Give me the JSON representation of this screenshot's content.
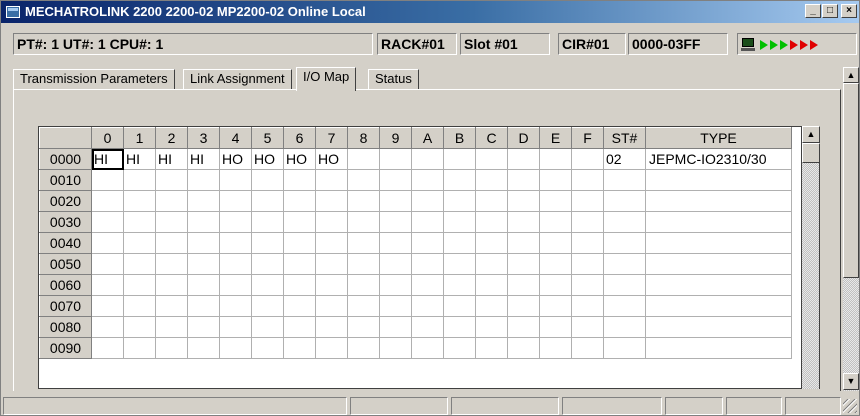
{
  "window": {
    "title": "MECHATROLINK   2200  2200-02  MP2200-02 Online  Local",
    "minimize_label": "_",
    "maximize_label": "□",
    "close_label": "×"
  },
  "info": {
    "pt_ut_cpu": "PT#: 1 UT#: 1 CPU#: 1",
    "rack": "RACK#01",
    "slot": "Slot #01",
    "cir": "CIR#01",
    "range": "0000-03FF"
  },
  "tabs": [
    {
      "label": "Transmission Parameters",
      "active": false
    },
    {
      "label": "Link Assignment",
      "active": false
    },
    {
      "label": "I/O Map",
      "active": true
    },
    {
      "label": "Status",
      "active": false
    }
  ],
  "grid": {
    "columns": [
      "0",
      "1",
      "2",
      "3",
      "4",
      "5",
      "6",
      "7",
      "8",
      "9",
      "A",
      "B",
      "C",
      "D",
      "E",
      "F",
      "ST#",
      "TYPE"
    ],
    "rows": [
      {
        "addr": "0000",
        "cells": [
          "HI",
          "HI",
          "HI",
          "HI",
          "HO",
          "HO",
          "HO",
          "HO",
          "",
          "",
          "",
          "",
          "",
          "",
          "",
          ""
        ],
        "st": "02",
        "type": "JEPMC-IO2310/30"
      },
      {
        "addr": "0010",
        "cells": [
          "",
          "",
          "",
          "",
          "",
          "",
          "",
          "",
          "",
          "",
          "",
          "",
          "",
          "",
          "",
          ""
        ],
        "st": "",
        "type": ""
      },
      {
        "addr": "0020",
        "cells": [
          "",
          "",
          "",
          "",
          "",
          "",
          "",
          "",
          "",
          "",
          "",
          "",
          "",
          "",
          "",
          ""
        ],
        "st": "",
        "type": ""
      },
      {
        "addr": "0030",
        "cells": [
          "",
          "",
          "",
          "",
          "",
          "",
          "",
          "",
          "",
          "",
          "",
          "",
          "",
          "",
          "",
          ""
        ],
        "st": "",
        "type": ""
      },
      {
        "addr": "0040",
        "cells": [
          "",
          "",
          "",
          "",
          "",
          "",
          "",
          "",
          "",
          "",
          "",
          "",
          "",
          "",
          "",
          ""
        ],
        "st": "",
        "type": ""
      },
      {
        "addr": "0050",
        "cells": [
          "",
          "",
          "",
          "",
          "",
          "",
          "",
          "",
          "",
          "",
          "",
          "",
          "",
          "",
          "",
          ""
        ],
        "st": "",
        "type": ""
      },
      {
        "addr": "0060",
        "cells": [
          "",
          "",
          "",
          "",
          "",
          "",
          "",
          "",
          "",
          "",
          "",
          "",
          "",
          "",
          "",
          ""
        ],
        "st": "",
        "type": ""
      },
      {
        "addr": "0070",
        "cells": [
          "",
          "",
          "",
          "",
          "",
          "",
          "",
          "",
          "",
          "",
          "",
          "",
          "",
          "",
          "",
          ""
        ],
        "st": "",
        "type": ""
      },
      {
        "addr": "0080",
        "cells": [
          "",
          "",
          "",
          "",
          "",
          "",
          "",
          "",
          "",
          "",
          "",
          "",
          "",
          "",
          "",
          ""
        ],
        "st": "",
        "type": ""
      },
      {
        "addr": "0090",
        "cells": [
          "",
          "",
          "",
          "",
          "",
          "",
          "",
          "",
          "",
          "",
          "",
          "",
          "",
          "",
          "",
          ""
        ],
        "st": "",
        "type": ""
      }
    ],
    "selected_cell": {
      "row": 0,
      "col": 0
    }
  },
  "icons": {
    "status_arrows": [
      "green",
      "green",
      "green",
      "red",
      "red",
      "red"
    ],
    "scroll_up": "▲",
    "scroll_down": "▼"
  },
  "colors": {
    "titlebar_start": "#0a246a",
    "titlebar_end": "#a6caf0",
    "arrow_green": "#00c000",
    "arrow_red": "#e00000"
  }
}
